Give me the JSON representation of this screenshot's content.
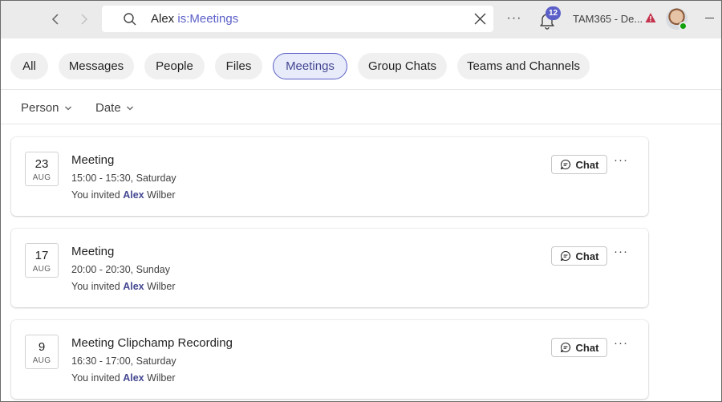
{
  "topbar": {
    "back_icon": "chevron-left-icon",
    "forward_icon": "chevron-right-icon",
    "search": {
      "query": "Alex",
      "qualifier": "is:Meetings"
    },
    "more_label": "···",
    "notifications_count": "12",
    "tenant_name": "TAM365 - De...",
    "warning_icon": "warning-icon"
  },
  "filters": {
    "tabs": [
      {
        "label": "All"
      },
      {
        "label": "Messages"
      },
      {
        "label": "People"
      },
      {
        "label": "Files"
      },
      {
        "label": "Meetings",
        "active": true
      },
      {
        "label": "Group Chats"
      },
      {
        "label": "Teams and Channels"
      }
    ],
    "dropdowns": [
      {
        "label": "Person"
      },
      {
        "label": "Date"
      }
    ]
  },
  "results": [
    {
      "day": "23",
      "month": "AUG",
      "title": "Meeting",
      "time": "15:00 - 15:30, Saturday",
      "invite_prefix": "You invited",
      "invite_match": "Alex",
      "invite_suffix": "Wilber",
      "chat_label": "Chat",
      "more_label": "···"
    },
    {
      "day": "17",
      "month": "AUG",
      "title": "Meeting",
      "time": "20:00 - 20:30, Sunday",
      "invite_prefix": "You invited",
      "invite_match": "Alex",
      "invite_suffix": "Wilber",
      "chat_label": "Chat",
      "more_label": "···"
    },
    {
      "day": "9",
      "month": "AUG",
      "title": "Meeting Clipchamp Recording",
      "time": "16:30 - 17:00, Saturday",
      "invite_prefix": "You invited",
      "invite_match": "Alex",
      "invite_suffix": "Wilber",
      "chat_label": "Chat",
      "more_label": "···"
    }
  ],
  "colors": {
    "accent": "#5b5fc7",
    "accent_text": "#444791",
    "active_pill_bg": "#e8ebfa",
    "topbar_bg": "#ebebeb",
    "presence_available": "#13a10e",
    "warning": "#c4314b"
  }
}
